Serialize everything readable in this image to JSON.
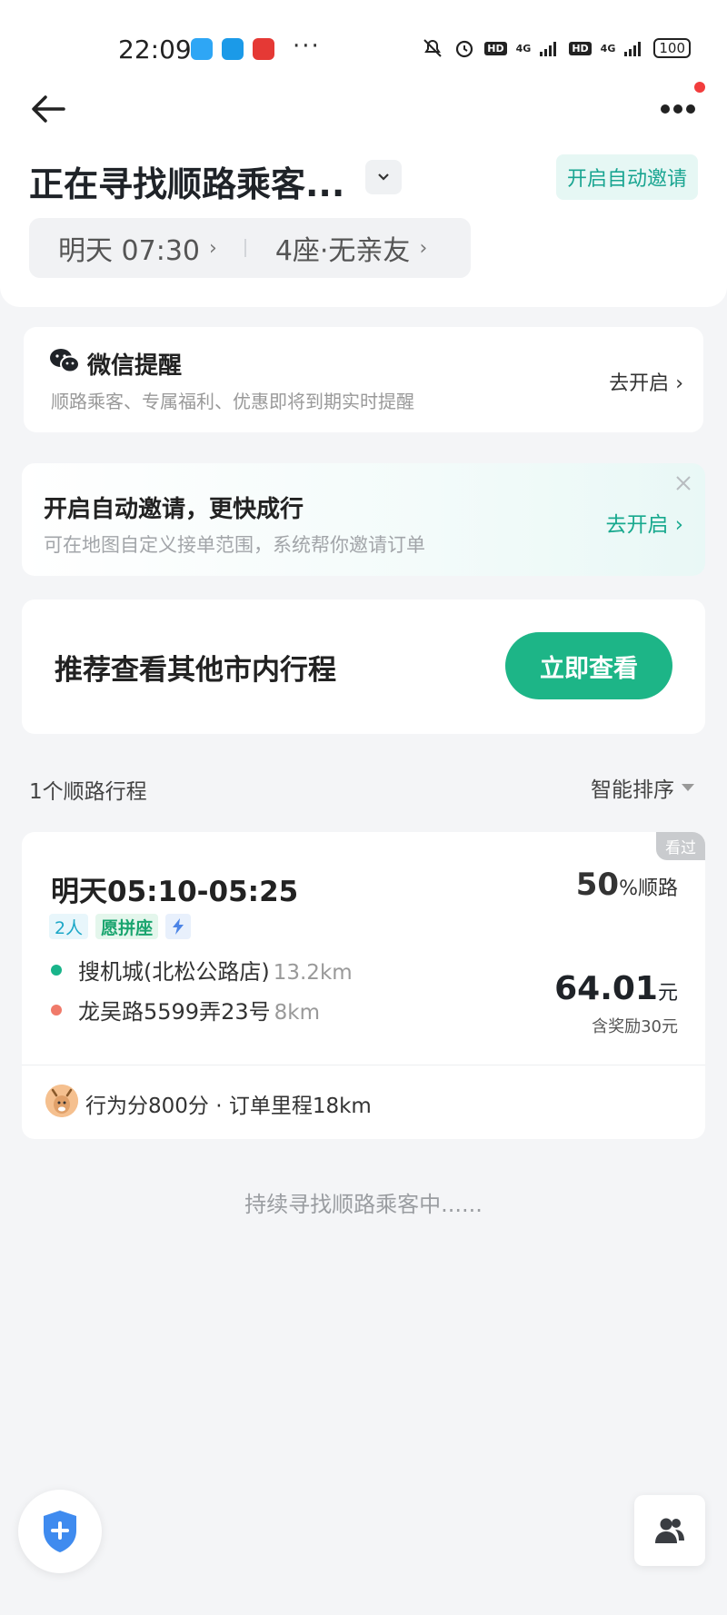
{
  "status_bar": {
    "time": "22:09",
    "battery": "100",
    "network_1": "4G",
    "network_2": "4G",
    "hd_label": "HD"
  },
  "header": {
    "title": "正在寻找顺路乘客...",
    "auto_invite_label": "开启自动邀请",
    "trip_time": "明天 07:30",
    "trip_seats": "4座·无亲友"
  },
  "wechat_reminder": {
    "title": "微信提醒",
    "subtitle": "顺路乘客、专属福利、优惠即将到期实时提醒",
    "action": "去开启"
  },
  "auto_invite_banner": {
    "title": "开启自动邀请，更快成行",
    "subtitle": "可在地图自定义接单范围，系统帮你邀请订单",
    "action": "去开启"
  },
  "recommend": {
    "text": "推荐查看其他市内行程",
    "button": "立即查看"
  },
  "list": {
    "count_label": "1个顺路行程",
    "sort_label": "智能排序"
  },
  "trip": {
    "seen_badge": "看过",
    "time": "明天05:10-05:25",
    "match_value": "50",
    "match_unit": "%顺路",
    "tags": [
      "2人",
      "愿拼座"
    ],
    "start_name": "搜机城(北松公路店)",
    "start_dist": "13.2km",
    "end_name": "龙吴路5599弄23号",
    "end_dist": "8km",
    "price": "64.01",
    "price_unit": "元",
    "bonus": "含奖励30元",
    "driver_info": "行为分800分 · 订单里程18km"
  },
  "footer": {
    "searching": "持续寻找顺路乘客中......"
  },
  "colors": {
    "accent_green": "#1db587",
    "teal": "#19a591",
    "start_dot": "#19b48a",
    "end_dot": "#f07a6a"
  }
}
